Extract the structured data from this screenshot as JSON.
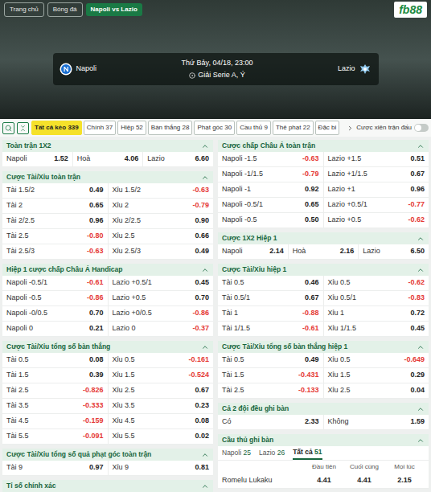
{
  "nav": {
    "tabs": [
      {
        "label": "Trang chủ",
        "selected": false
      },
      {
        "label": "Bóng đá",
        "selected": false
      },
      {
        "label": "Napoli vs Lazio",
        "selected": true
      }
    ],
    "logo": "fb88"
  },
  "match": {
    "home": "Napoli",
    "away": "Lazio",
    "date": "Thứ Bảy, 04/18, 23:00",
    "league": "Giải Serie A, Ý"
  },
  "market_tabs": [
    {
      "label": "Tất cả kèo",
      "count": "339",
      "selected": true
    },
    {
      "label": "Chính",
      "count": "37",
      "selected": false
    },
    {
      "label": "Hiệp",
      "count": "52",
      "selected": false
    },
    {
      "label": "Bàn thắng",
      "count": "28",
      "selected": false
    },
    {
      "label": "Phạt góc",
      "count": "30",
      "selected": false
    },
    {
      "label": "Cầu thủ",
      "count": "9",
      "selected": false
    },
    {
      "label": "Thẻ phạt",
      "count": "22",
      "selected": false
    },
    {
      "label": "Đặc bi",
      "count": "",
      "selected": false
    }
  ],
  "parlay": {
    "label": "Cược xiên trận đấu",
    "on": false
  },
  "left_sections": [
    {
      "kind": "odds",
      "title": "Toàn trận 1X2",
      "expanded": true,
      "rows": [
        [
          {
            "label": "Napoli",
            "odds": "1.52"
          },
          {
            "label": "Hoà",
            "odds": "4.06"
          },
          {
            "label": "Lazio",
            "odds": "6.60"
          }
        ]
      ]
    },
    {
      "kind": "odds",
      "title": "Cược Tài/Xỉu toàn trận",
      "expanded": true,
      "rows": [
        [
          {
            "label": "Tài 1.5/2",
            "odds": "0.49"
          },
          {
            "label": "Xỉu 1.5/2",
            "odds": "-0.63"
          }
        ],
        [
          {
            "label": "Tài 2",
            "odds": "0.65"
          },
          {
            "label": "Xỉu 2",
            "odds": "-0.79"
          }
        ],
        [
          {
            "label": "Tài 2/2.5",
            "odds": "0.96"
          },
          {
            "label": "Xỉu 2/2.5",
            "odds": "0.90"
          }
        ],
        [
          {
            "label": "Tài 2.5",
            "odds": "-0.80"
          },
          {
            "label": "Xỉu 2.5",
            "odds": "0.66"
          }
        ],
        [
          {
            "label": "Tài 2.5/3",
            "odds": "-0.63"
          },
          {
            "label": "Xỉu 2.5/3",
            "odds": "0.49"
          }
        ]
      ]
    },
    {
      "kind": "odds",
      "title": "Hiệp 1 cược chấp Châu Á Handicap",
      "expanded": true,
      "rows": [
        [
          {
            "label": "Napoli -0.5/1",
            "odds": "-0.61"
          },
          {
            "label": "Lazio +0.5/1",
            "odds": "0.45"
          }
        ],
        [
          {
            "label": "Napoli -0.5",
            "odds": "-0.86"
          },
          {
            "label": "Lazio +0.5",
            "odds": "0.70"
          }
        ],
        [
          {
            "label": "Napoli -0/0.5",
            "odds": "0.70"
          },
          {
            "label": "Lazio +0/0.5",
            "odds": "-0.86"
          }
        ],
        [
          {
            "label": "Napoli 0",
            "odds": "0.21"
          },
          {
            "label": "Lazio 0",
            "odds": "-0.37"
          }
        ]
      ]
    },
    {
      "kind": "odds",
      "title": "Cược Tài/Xỉu tổng số bàn thắng",
      "expanded": true,
      "rows": [
        [
          {
            "label": "Tài 0.5",
            "odds": "0.08"
          },
          {
            "label": "Xỉu 0.5",
            "odds": "-0.161"
          }
        ],
        [
          {
            "label": "Tài 1.5",
            "odds": "0.39"
          },
          {
            "label": "Xỉu 1.5",
            "odds": "-0.524"
          }
        ],
        [
          {
            "label": "Tài 2.5",
            "odds": "-0.826"
          },
          {
            "label": "Xỉu 2.5",
            "odds": "0.67"
          }
        ],
        [
          {
            "label": "Tài 3.5",
            "odds": "-0.333"
          },
          {
            "label": "Xỉu 3.5",
            "odds": "0.23"
          }
        ],
        [
          {
            "label": "Tài 4.5",
            "odds": "-0.159"
          },
          {
            "label": "Xỉu 4.5",
            "odds": "0.08"
          }
        ],
        [
          {
            "label": "Tài 5.5",
            "odds": "-0.091"
          },
          {
            "label": "Xỉu 5.5",
            "odds": "0.02"
          }
        ]
      ]
    },
    {
      "kind": "odds",
      "title": "Cược Tài/Xỉu tổng số quả phạt góc toàn trận",
      "expanded": true,
      "rows": [
        [
          {
            "label": "Tài 9",
            "odds": "0.97"
          },
          {
            "label": "Xỉu 9",
            "odds": "0.81"
          }
        ]
      ]
    },
    {
      "kind": "odds",
      "title": "Tỉ số chính xác",
      "expanded": true,
      "rows": []
    }
  ],
  "right_sections": [
    {
      "kind": "odds",
      "title": "Cược chấp Châu Á toàn trận",
      "expanded": true,
      "rows": [
        [
          {
            "label": "Napoli -1.5",
            "odds": "-0.63"
          },
          {
            "label": "Lazio +1.5",
            "odds": "0.51"
          }
        ],
        [
          {
            "label": "Napoli -1/1.5",
            "odds": "-0.79"
          },
          {
            "label": "Lazio +1/1.5",
            "odds": "0.67"
          }
        ],
        [
          {
            "label": "Napoli -1",
            "odds": "0.92"
          },
          {
            "label": "Lazio +1",
            "odds": "0.96"
          }
        ],
        [
          {
            "label": "Napoli -0.5/1",
            "odds": "0.65"
          },
          {
            "label": "Lazio +0.5/1",
            "odds": "-0.77"
          }
        ],
        [
          {
            "label": "Napoli -0.5",
            "odds": "0.50"
          },
          {
            "label": "Lazio +0.5",
            "odds": "-0.62"
          }
        ]
      ]
    },
    {
      "kind": "odds",
      "title": "Cược 1X2 Hiệp 1",
      "expanded": true,
      "rows": [
        [
          {
            "label": "Napoli",
            "odds": "2.14"
          },
          {
            "label": "Hoà",
            "odds": "2.16"
          },
          {
            "label": "Lazio",
            "odds": "6.50"
          }
        ]
      ]
    },
    {
      "kind": "odds",
      "title": "Cược Tài/Xỉu hiệp 1",
      "expanded": true,
      "rows": [
        [
          {
            "label": "Tài 0.5",
            "odds": "0.46"
          },
          {
            "label": "Xỉu 0.5",
            "odds": "-0.62"
          }
        ],
        [
          {
            "label": "Tài 0.5/1",
            "odds": "0.67"
          },
          {
            "label": "Xỉu 0.5/1",
            "odds": "-0.83"
          }
        ],
        [
          {
            "label": "Tài 1",
            "odds": "-0.88"
          },
          {
            "label": "Xỉu 1",
            "odds": "0.72"
          }
        ],
        [
          {
            "label": "Tài 1/1.5",
            "odds": "-0.61"
          },
          {
            "label": "Xỉu 1/1.5",
            "odds": "0.45"
          }
        ]
      ]
    },
    {
      "kind": "odds",
      "title": "Cược Tài/Xỉu tổng số bàn thắng hiệp 1",
      "expanded": true,
      "rows": [
        [
          {
            "label": "Tài 0.5",
            "odds": "0.49"
          },
          {
            "label": "Xỉu 0.5",
            "odds": "-0.649"
          }
        ],
        [
          {
            "label": "Tài 1.5",
            "odds": "-0.431"
          },
          {
            "label": "Xỉu 1.5",
            "odds": "0.29"
          }
        ],
        [
          {
            "label": "Tài 2.5",
            "odds": "-0.133"
          },
          {
            "label": "Xỉu 2.5",
            "odds": "0.04"
          }
        ]
      ]
    },
    {
      "kind": "odds",
      "title": "Cả 2 đội đều ghi bàn",
      "expanded": true,
      "rows": [
        [
          {
            "label": "Có",
            "odds": "2.33"
          },
          {
            "label": "Không",
            "odds": "1.59"
          }
        ]
      ]
    },
    {
      "kind": "scorers",
      "title": "Cầu thủ ghi bàn",
      "expanded": true,
      "tabs": [
        {
          "label": "Napoli",
          "count": "25",
          "selected": false
        },
        {
          "label": "Lazio",
          "count": "26",
          "selected": false
        },
        {
          "label": "Tất cả",
          "count": "51",
          "selected": true
        }
      ],
      "columns": [
        "Đầu tiên",
        "Cuối cùng",
        "Mọi lúc"
      ],
      "rows": [
        {
          "name": "Romelu Lukaku",
          "odds": [
            "4.41",
            "4.41",
            "2.15"
          ]
        }
      ]
    }
  ]
}
